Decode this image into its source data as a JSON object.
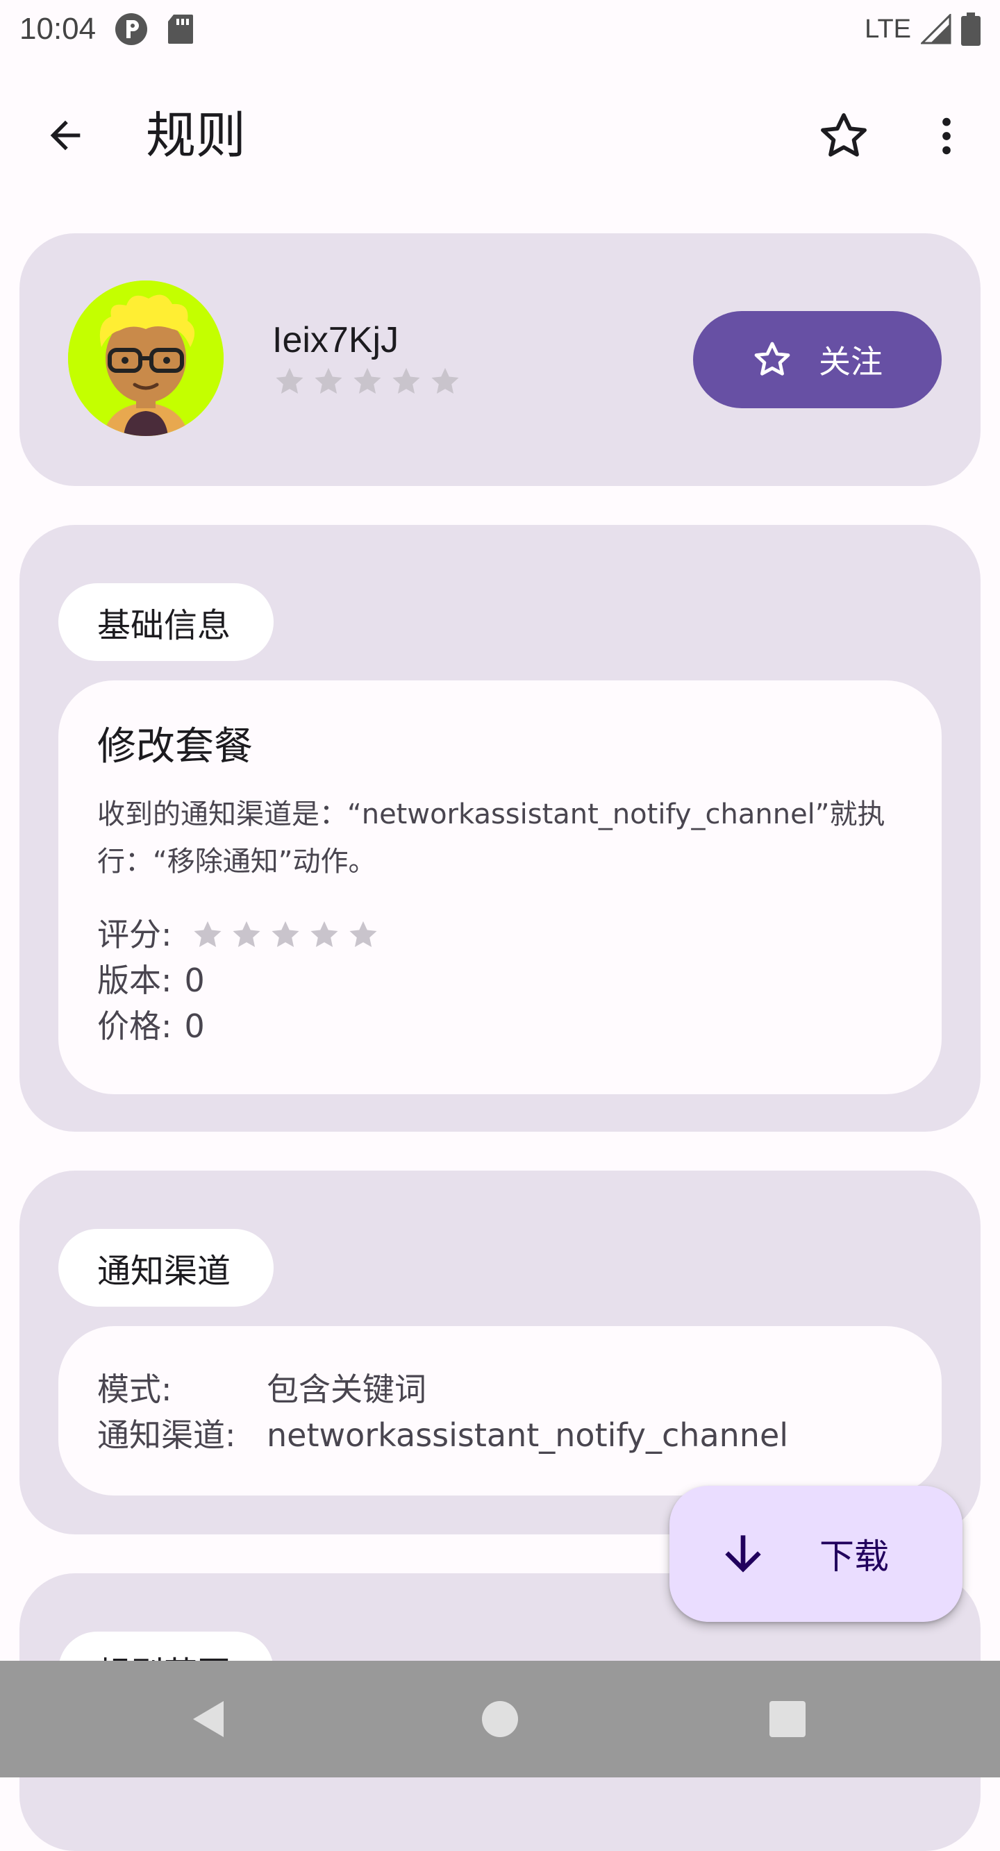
{
  "status_bar": {
    "time": "10:04",
    "network": "LTE"
  },
  "app_bar": {
    "title": "规则"
  },
  "profile": {
    "username": "Ieix7KjJ",
    "rating": 0,
    "follow_label": "关注"
  },
  "basic_info": {
    "section_label": "基础信息",
    "rule_name": "修改套餐",
    "description": "收到的通知渠道是：“networkassistant_notify_channel”就执行：“移除通知”动作。",
    "rating_label": "评分:",
    "rating": 0,
    "version_label": "版本:",
    "version": "0",
    "price_label": "价格:",
    "price": "0"
  },
  "channel": {
    "section_label": "通知渠道",
    "mode_label": "模式:",
    "mode_value": "包含关键词",
    "channel_label": "通知渠道:",
    "channel_value": "networkassistant_notify_channel"
  },
  "range": {
    "section_label": "规则范围"
  },
  "fab": {
    "label": "下载"
  },
  "colors": {
    "primary": "#6750A4",
    "card_bg": "#E7E0EC",
    "fab_bg": "#EADDFF",
    "star_empty": "#C9C4CC"
  }
}
